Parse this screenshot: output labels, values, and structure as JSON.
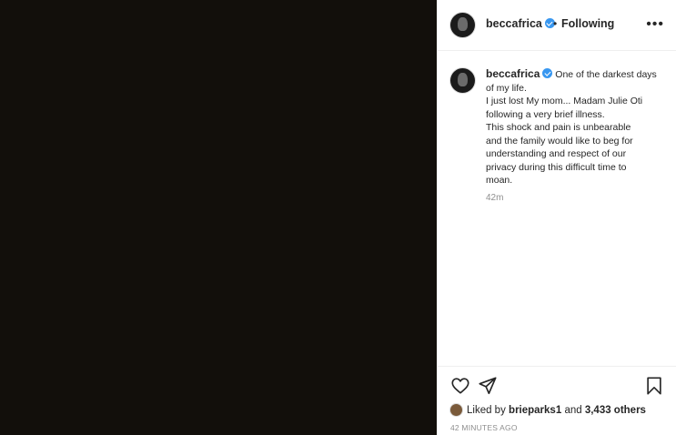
{
  "header": {
    "username": "beccafrica",
    "separator": "•",
    "follow_status": "Following",
    "more_icon": "more-horizontal-icon"
  },
  "caption": {
    "username": "beccafrica",
    "lines": [
      "One of the darkest days",
      "of my life.",
      "I just lost My mom... Madam Julie Oti",
      "following a very brief illness.",
      "This shock and pain is unbearable",
      "and the family would like to beg for",
      "understanding and respect of our",
      "privacy during this difficult time to",
      "moan."
    ],
    "time": "42m"
  },
  "likes": {
    "prefix": "Liked by",
    "liker": "brieparks1",
    "connector": "and",
    "others": "3,433 others"
  },
  "timestamp": "42 MINUTES AGO",
  "colors": {
    "media_bg": "#120f0b",
    "verified": "#3897f0",
    "secondary_text": "#8e8e8e"
  }
}
